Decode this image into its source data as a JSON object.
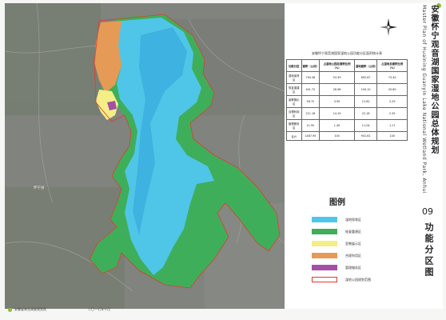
{
  "header": {
    "title_cn": "安徽怀宁观音湖国家湿地公园总体规划",
    "title_en": "Master Plan of Huaining Guanyin Lake National Wetland Park, Anhui"
  },
  "sheet": {
    "number": "09",
    "name": "功能分区图"
  },
  "map": {
    "place_label": "怀宁县"
  },
  "stats": {
    "title": "安徽怀宁观音湖国家湿地公园功能分区面积统计表",
    "columns": [
      "功能分区",
      "面积（公顷）",
      "占湿地公园总面积比例（%）",
      "湿地面积（公顷）",
      "占湿地总面积比例（%）"
    ],
    "rows": [
      [
        "湿地保育区",
        "794.38",
        "53.39",
        "692.67",
        "73.40"
      ],
      [
        "恢复重建区",
        "401.72",
        "26.98",
        "194.10",
        "20.60"
      ],
      [
        "宣教展示区",
        "58.72",
        "3.95",
        "21.62",
        "2.29"
      ],
      [
        "合理利用区",
        "211.18",
        "14.19",
        "22.18",
        "2.35"
      ],
      [
        "管理服务区",
        "21.95",
        "1.49",
        "11.04",
        "1.17"
      ],
      [
        "合计",
        "1487.95",
        "100",
        "941.61",
        "100"
      ]
    ]
  },
  "legend": {
    "title": "图例",
    "items": [
      {
        "label": "湿地保育区",
        "color": "#4fc6e8"
      },
      {
        "label": "恢复重建区",
        "color": "#3fae5a"
      },
      {
        "label": "宣教展示区",
        "color": "#f3ee86"
      },
      {
        "label": "合理利用区",
        "color": "#e59a55"
      },
      {
        "label": "管理服务区",
        "color": "#a44fa6"
      },
      {
        "label": "湿地公园规划范围",
        "color": "#e23b2e"
      }
    ]
  },
  "footer": {
    "org": "安徽省林业调查规划院",
    "date": "二〇一七年十月"
  }
}
